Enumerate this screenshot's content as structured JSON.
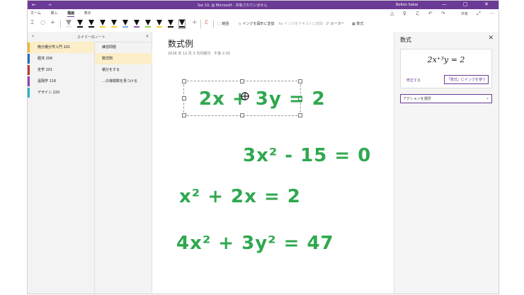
{
  "titlebar": {
    "back": "←",
    "forward": "→",
    "title": "Sat 10, @ Microsoft - 共有されていません",
    "user": "Bolton Sakai",
    "minimize": "—",
    "maximize": "□",
    "close": "✕"
  },
  "ribbon": {
    "tabs": [
      {
        "label": "ホーム"
      },
      {
        "label": "挿入"
      },
      {
        "label": "描画"
      },
      {
        "label": "表示"
      }
    ],
    "share": "共有",
    "tools": {
      "lasso": "範囲",
      "ink_to_shape": "インクを図形に変換",
      "ink_to_text": "インクをテキストに変換",
      "ruler": "ルーラー",
      "math": "数式"
    },
    "pen_colors": [
      "#e8e8e8",
      "#111111",
      "#111111",
      "#f2d33a",
      "#f2d33a",
      "#7fb0e6",
      "#9b59b6",
      "#8fd14f",
      "#f2d33a",
      "#111111",
      "#111111"
    ]
  },
  "nav": {
    "notebook": "エイミーのノート",
    "sections": [
      {
        "label": "微分積分学入門 101",
        "color": "#f0b429"
      },
      {
        "label": "経済 206",
        "color": "#1f6fbf"
      },
      {
        "label": "史学 101",
        "color": "#c0392b"
      },
      {
        "label": "遠隔学 116",
        "color": "#8e44ad"
      },
      {
        "label": "デザイン 220",
        "color": "#2bb3c0"
      }
    ],
    "pages": [
      {
        "label": "練習問題"
      },
      {
        "label": "数式例"
      },
      {
        "label": "積分をする"
      },
      {
        "label": "…の導関数を見つける"
      }
    ]
  },
  "page": {
    "title": "数式例",
    "date": "2018 年 12 月 3 日月曜日　午後 2:30",
    "ink_color": "#2fa84f",
    "equations": [
      {
        "text": "2x + 3y = 2"
      },
      {
        "text": "3x² - 15 = 0"
      },
      {
        "text": "x² + 2x = 2"
      },
      {
        "text": "4x² + 3y² = 47"
      }
    ]
  },
  "math_pane": {
    "title": "数式",
    "close": "✕",
    "expression": "2x⁺³y = 2",
    "fix_link": "修正する",
    "ink_button": "「数式」にインクを使う",
    "action_select": "アクションを選択",
    "accent": "#6b3a96"
  }
}
